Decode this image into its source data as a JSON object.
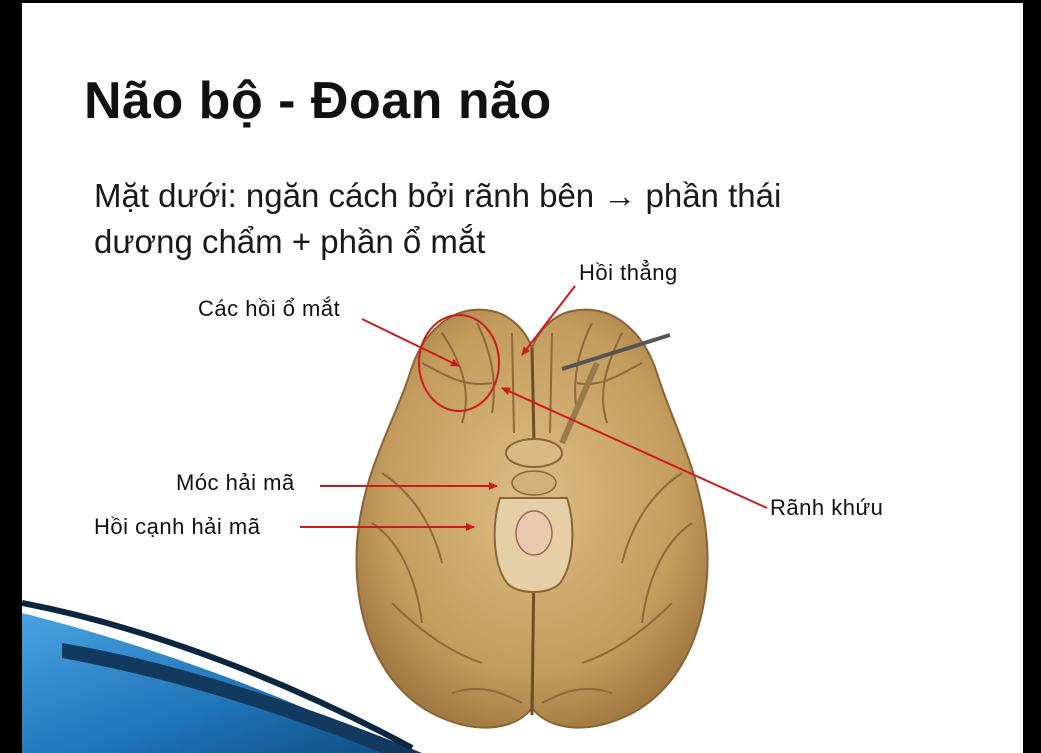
{
  "slide": {
    "title": "Não bộ - Đoan não",
    "body_line1": "Mặt dưới: ngăn cách bởi rãnh bên → phần thái",
    "body_line2": "dương chẩm + phần ổ mắt"
  },
  "labels": {
    "hoi_thang": "Hồi thẳng",
    "cac_hoi_o_mat": "Các hồi ổ mắt",
    "moc_hai_ma": "Móc hải mã",
    "hoi_canh_hai_ma": "Hồi cạnh hải mã",
    "ranh_khuu": "Rãnh khứu"
  },
  "colors": {
    "arrow": "#d01a1a",
    "brain": "#c9a66b",
    "accent_blue": "#1f73b7"
  }
}
